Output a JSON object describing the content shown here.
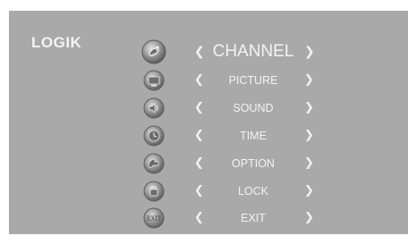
{
  "brand": "LOGIK",
  "menu": {
    "selected_index": 0,
    "items": [
      {
        "label": "CHANNEL",
        "icon": "channel-satellite-icon"
      },
      {
        "label": "PICTURE",
        "icon": "picture-tv-icon"
      },
      {
        "label": "SOUND",
        "icon": "sound-speaker-icon"
      },
      {
        "label": "TIME",
        "icon": "time-clock-icon"
      },
      {
        "label": "OPTION",
        "icon": "option-gear-icon"
      },
      {
        "label": "LOCK",
        "icon": "lock-icon"
      },
      {
        "label": "EXIT",
        "icon": "exit-icon"
      }
    ],
    "left_arrow": "❮",
    "right_arrow": "❯",
    "exit_icon_text": "EXIT"
  },
  "colors": {
    "background": "#a9a9a9",
    "text": "#f3f3f3",
    "icon_dark": "#5e5e5e",
    "icon_light": "#d8d8d8"
  }
}
